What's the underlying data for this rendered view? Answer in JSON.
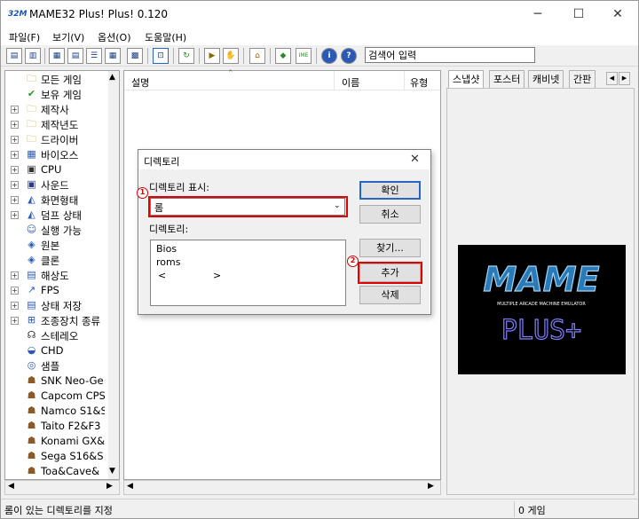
{
  "window": {
    "title": "MAME32 Plus! Plus! 0.120",
    "app_icon_text": "32M"
  },
  "titlebar_buttons": {
    "minimize": "─",
    "maximize": "☐",
    "close": "✕"
  },
  "menu": [
    "파일(F)",
    "보기(V)",
    "옵션(O)",
    "도움말(H)"
  ],
  "toolbar": {
    "search_value": "검색어 입력"
  },
  "tree": {
    "items": [
      {
        "label": "모든 게임",
        "icon": "folder-icon",
        "glyph": "🗀",
        "expandable": false
      },
      {
        "label": "보유 게임",
        "icon": "check-icon",
        "glyph": "✔",
        "expandable": false
      },
      {
        "label": "제작사",
        "icon": "folder-icon",
        "glyph": "🗀",
        "expandable": true
      },
      {
        "label": "제작년도",
        "icon": "folder-icon",
        "glyph": "🗀",
        "expandable": true
      },
      {
        "label": "드라이버",
        "icon": "folder-icon",
        "glyph": "🗀",
        "expandable": true
      },
      {
        "label": "바이오스",
        "icon": "chip-icon",
        "glyph": "▦",
        "expandable": true
      },
      {
        "label": "CPU",
        "icon": "cpu-icon",
        "glyph": "▣",
        "expandable": true
      },
      {
        "label": "사운드",
        "icon": "sound-chip-icon",
        "glyph": "▣",
        "expandable": true
      },
      {
        "label": "화면형태",
        "icon": "screen-icon",
        "glyph": "◭",
        "expandable": true
      },
      {
        "label": "덤프 상태",
        "icon": "dump-icon",
        "glyph": "◭",
        "expandable": true
      },
      {
        "label": "실행 가능",
        "icon": "runnable-icon",
        "glyph": "☺",
        "expandable": false
      },
      {
        "label": "원본",
        "icon": "original-icon",
        "glyph": "◈",
        "expandable": false
      },
      {
        "label": "클론",
        "icon": "clone-icon",
        "glyph": "◈",
        "expandable": false
      },
      {
        "label": "해상도",
        "icon": "resolution-icon",
        "glyph": "▤",
        "expandable": true
      },
      {
        "label": "FPS",
        "icon": "fps-icon",
        "glyph": "↗",
        "expandable": true
      },
      {
        "label": "상태 저장",
        "icon": "save-state-icon",
        "glyph": "▤",
        "expandable": true
      },
      {
        "label": "조종장치 종류",
        "icon": "controls-icon",
        "glyph": "⊞",
        "expandable": true
      },
      {
        "label": "스테레오",
        "icon": "headphones-icon",
        "glyph": "☊",
        "expandable": false
      },
      {
        "label": "CHD",
        "icon": "disk-icon",
        "glyph": "◒",
        "expandable": false
      },
      {
        "label": "샘플",
        "icon": "sample-icon",
        "glyph": "◎",
        "expandable": false
      },
      {
        "label": "SNK Neo-Ge",
        "icon": "game-sprite-icon",
        "glyph": "☗",
        "expandable": false
      },
      {
        "label": "Capcom CPS",
        "icon": "game-sprite-icon",
        "glyph": "☗",
        "expandable": false
      },
      {
        "label": "Namco S1&S",
        "icon": "game-sprite-icon",
        "glyph": "☗",
        "expandable": false
      },
      {
        "label": "Taito F2&F3",
        "icon": "game-sprite-icon",
        "glyph": "☗",
        "expandable": false
      },
      {
        "label": "Konami GX&",
        "icon": "game-sprite-icon",
        "glyph": "☗",
        "expandable": false
      },
      {
        "label": "Sega S16&S",
        "icon": "game-sprite-icon",
        "glyph": "☗",
        "expandable": false
      },
      {
        "label": "Toa&Cave&",
        "icon": "game-sprite-icon",
        "glyph": "☗",
        "expandable": false
      }
    ]
  },
  "list": {
    "columns": [
      "설명",
      "이름",
      "유형"
    ]
  },
  "right_tabs": [
    "스냅샷",
    "포스터",
    "캐비넷",
    "간판"
  ],
  "logo": {
    "main": "MAME",
    "tagline": "MULTIPLE ARCADE MACHINE EMULATOR",
    "sub": "PLUS+"
  },
  "dialog": {
    "title": "디렉토리",
    "show_label": "디렉토리 표시:",
    "selected_type": "롬",
    "dir_label": "디렉토리:",
    "dirs": [
      "Bios",
      "roms"
    ],
    "scroll_left": "<",
    "scroll_right": ">",
    "btn_ok": "확인",
    "btn_cancel": "취소",
    "btn_browse": "찾기...",
    "btn_add": "추가",
    "btn_delete": "삭제",
    "marker1": "1",
    "marker2": "2"
  },
  "status": {
    "left": "롬이 있는 디렉토리를 지정",
    "right": "0 게임"
  }
}
